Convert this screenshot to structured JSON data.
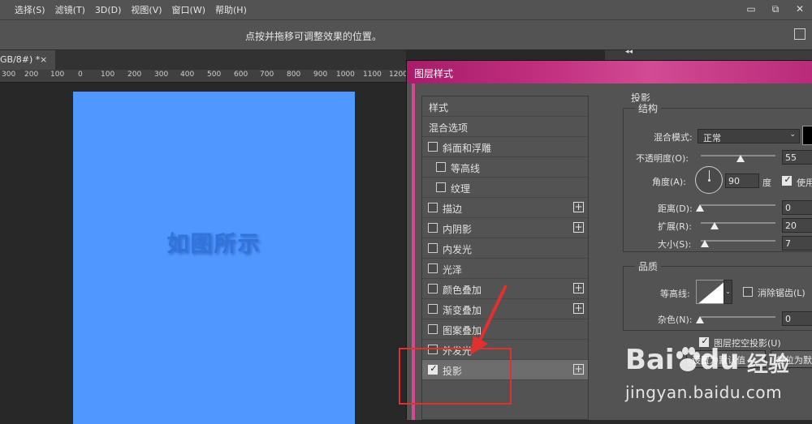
{
  "menubar": {
    "items": [
      "选择(S)",
      "滤镜(T)",
      "3D(D)",
      "视图(V)",
      "窗口(W)",
      "帮助(H)"
    ],
    "window_controls": [
      "▭",
      "⧉",
      "✕"
    ]
  },
  "options_bar": {
    "hint": "点按并拖移可调整效果的位置。"
  },
  "document_tab": {
    "label": "GB/8#) *",
    "close": "×"
  },
  "ruler": {
    "labels": [
      "300",
      "200",
      "100",
      "0",
      "100",
      "200",
      "300",
      "400",
      "500",
      "600",
      "700",
      "800",
      "900",
      "1000",
      "1100",
      "1200"
    ]
  },
  "canvas": {
    "text": "如图所示",
    "color": "#5098ff"
  },
  "panel": {
    "collapse": "◂◂"
  },
  "dialog": {
    "title": "图层样式",
    "title_color": "#c2307f",
    "styles_header": "样式",
    "blend_options": "混合选项",
    "effects": [
      {
        "label": "斜面和浮雕",
        "checked": false,
        "indent": false,
        "plus": false
      },
      {
        "label": "等高线",
        "checked": false,
        "indent": true,
        "plus": false
      },
      {
        "label": "纹理",
        "checked": false,
        "indent": true,
        "plus": false
      },
      {
        "label": "描边",
        "checked": false,
        "indent": false,
        "plus": true
      },
      {
        "label": "内阴影",
        "checked": false,
        "indent": false,
        "plus": true
      },
      {
        "label": "内发光",
        "checked": false,
        "indent": false,
        "plus": false
      },
      {
        "label": "光泽",
        "checked": false,
        "indent": false,
        "plus": false
      },
      {
        "label": "颜色叠加",
        "checked": false,
        "indent": false,
        "plus": true
      },
      {
        "label": "渐变叠加",
        "checked": false,
        "indent": false,
        "plus": true
      },
      {
        "label": "图案叠加",
        "checked": false,
        "indent": false,
        "plus": false
      },
      {
        "label": "外发光",
        "checked": false,
        "indent": false,
        "plus": false
      },
      {
        "label": "投影",
        "checked": true,
        "indent": false,
        "plus": true
      }
    ],
    "settings": {
      "title": "投影",
      "structure_label": "结构",
      "blend_mode_label": "混合模式:",
      "blend_mode_value": "正常",
      "opacity_label": "不透明度(O):",
      "opacity_value": "55",
      "angle_label": "角度(A):",
      "angle_value": "90",
      "angle_unit": "度",
      "global_light_label": "使用",
      "distance_label": "距离(D):",
      "distance_value": "0",
      "spread_label": "扩展(R):",
      "spread_value": "20",
      "size_label": "大小(S):",
      "size_value": "7",
      "quality_label": "品质",
      "contour_label": "等高线:",
      "antialias_label": "消除锯齿(L)",
      "noise_label": "杂色(N):",
      "noise_value": "0",
      "knockout_label": "图层挖空投影(U)",
      "default_button": "设置为默认值",
      "reset_button": "复位为默认"
    }
  },
  "annotation": {
    "color": "#e0302f"
  },
  "watermark": {
    "brand": "Bai",
    "brand_suffix": "du",
    "cn": "经验",
    "url": "jingyan.baidu.com"
  }
}
